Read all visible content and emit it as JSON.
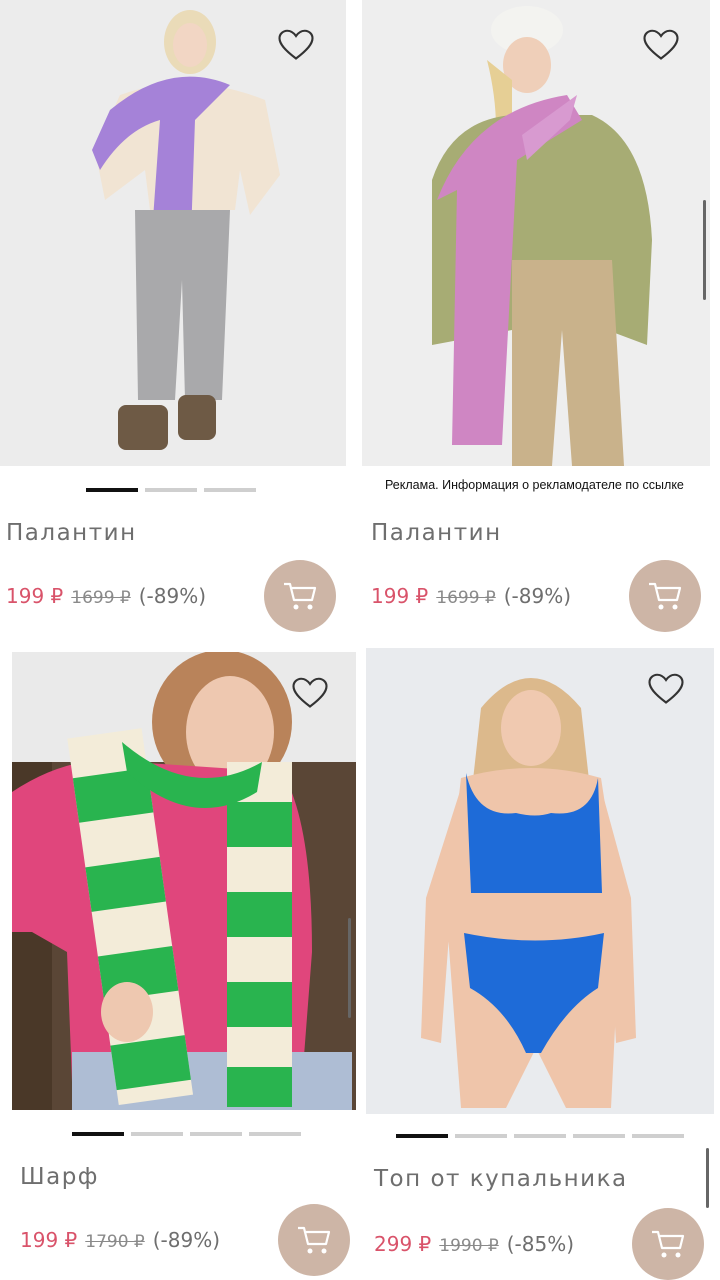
{
  "products": [
    {
      "name": "Палантин",
      "price_new": "199 ₽",
      "price_old": "1699 ₽",
      "discount": "(-89%)",
      "images_count": 3,
      "active_index": 0
    },
    {
      "name": "Палантин",
      "price_new": "199 ₽",
      "price_old": "1699 ₽",
      "discount": "(-89%)"
    },
    {
      "name": "Шарф",
      "price_new": "199 ₽",
      "price_old": "1790 ₽",
      "discount": "(-89%)",
      "images_count": 4,
      "active_index": 0
    },
    {
      "name": "Топ от купальника",
      "price_new": "299 ₽",
      "price_old": "1990 ₽",
      "discount": "(-85%)",
      "images_count": 5,
      "active_index": 0
    }
  ],
  "ad_notice": "Реклама. Информация о рекламодателе по ссылке",
  "icons": {
    "favorite": "heart-icon",
    "cart": "cart-icon"
  },
  "colors": {
    "price_accent": "#d9536a",
    "cart_button": "#cdb5a6"
  }
}
